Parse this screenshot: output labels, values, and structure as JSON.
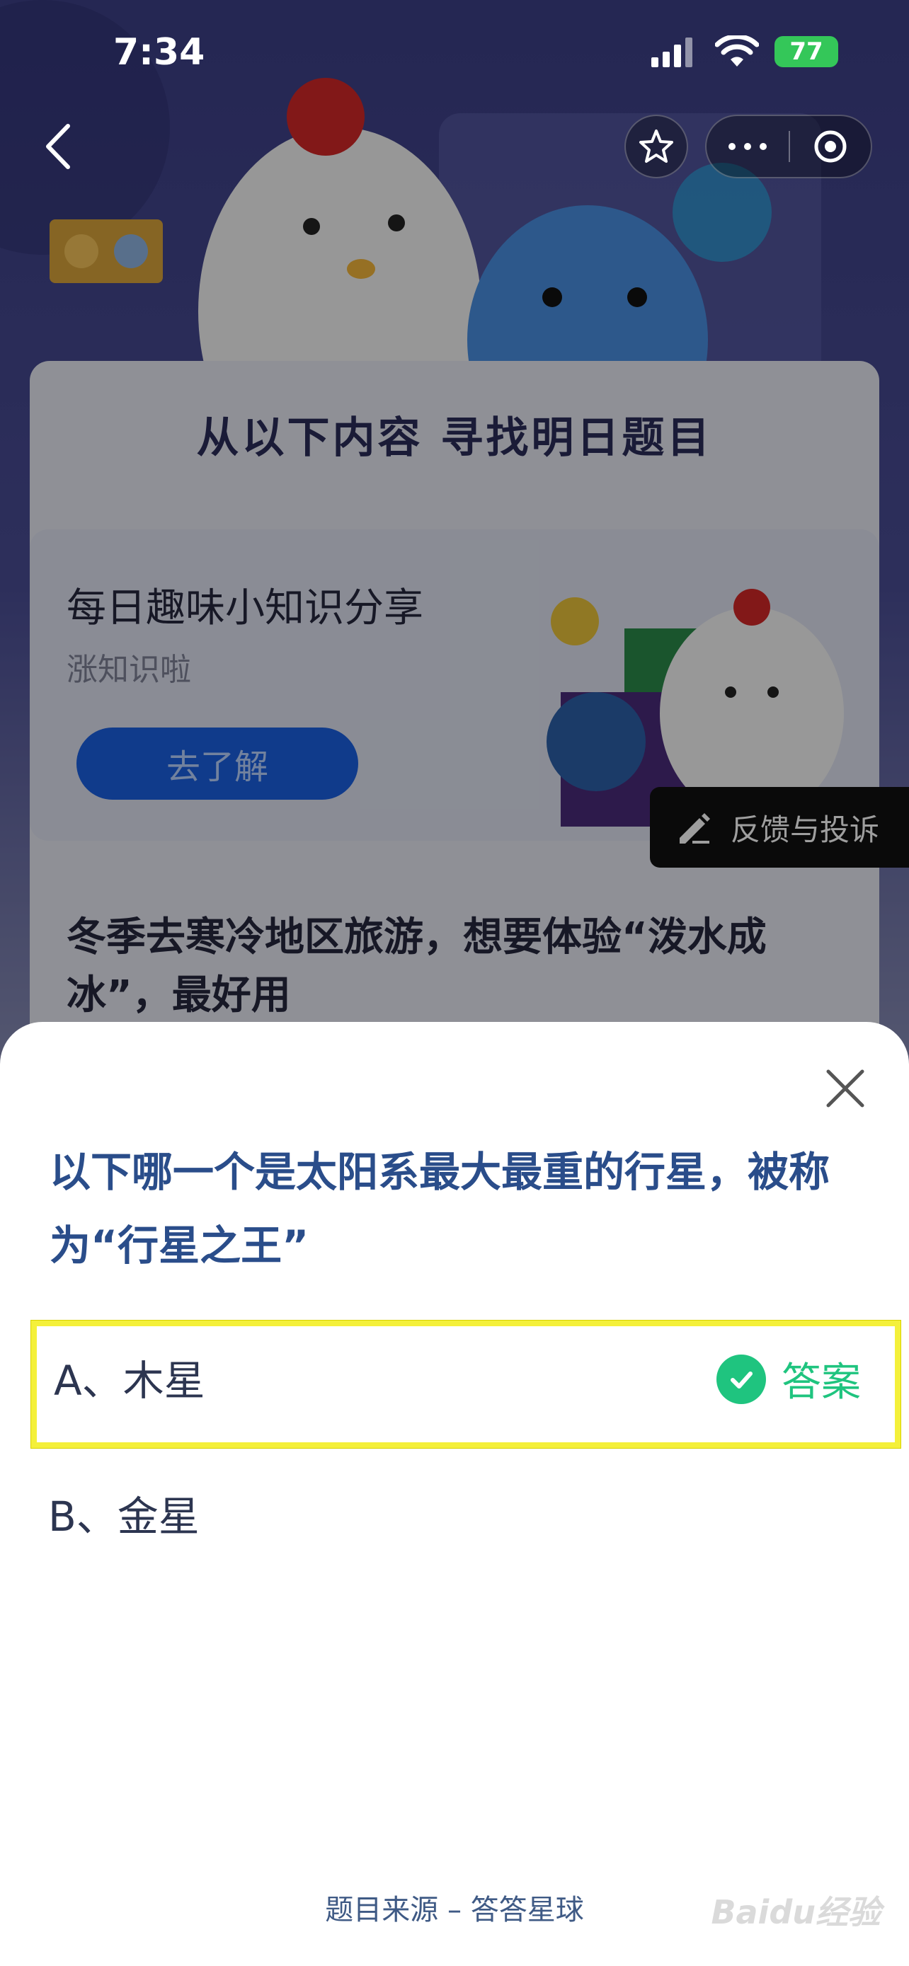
{
  "status_bar": {
    "time": "7:34",
    "battery": "77"
  },
  "background": {
    "panel_title": "从以下内容 寻找明日题目",
    "card": {
      "title": "每日趣味小知识分享",
      "subtitle": "涨知识啦",
      "button": "去了解"
    },
    "card2": {
      "question": "冬季去寒冷地区旅游，想要体验“泼水成冰”，最好用"
    },
    "feedback": "反馈与投诉"
  },
  "sheet": {
    "question": "以下哪一个是太阳系最大最重的行星，被称为“行星之王”",
    "options": [
      {
        "label": "A、木星",
        "answer_tag": "答案"
      },
      {
        "label": "B、金星"
      }
    ],
    "source": "题目来源 – 答答星球",
    "watermark": "Baidu经验"
  },
  "colors": {
    "answer_green": "#1fc47f",
    "highlight_yellow": "#f4f03a",
    "question_blue": "#2a4d8a"
  },
  "icons": [
    "back-chevron-icon",
    "star-icon",
    "more-icon",
    "target-icon",
    "close-icon",
    "check-icon",
    "pencil-icon",
    "signal-icon",
    "wifi-icon"
  ]
}
